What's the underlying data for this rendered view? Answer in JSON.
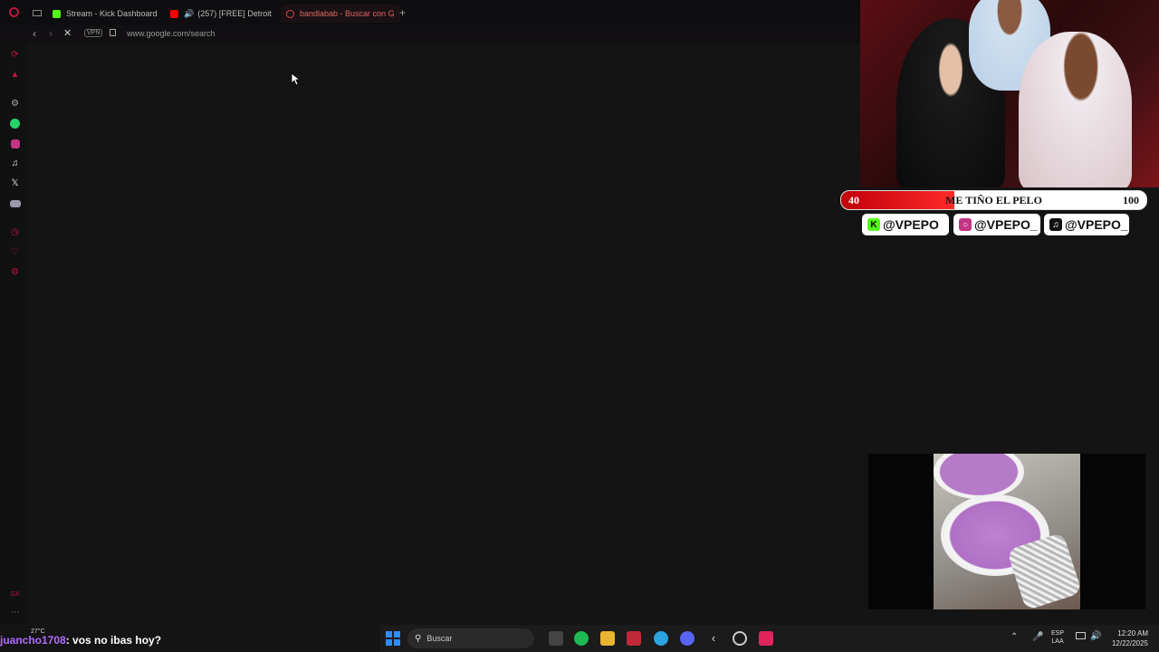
{
  "browser": {
    "tabs": [
      {
        "label": "Stream - Kick Dashboard"
      },
      {
        "label": "(257) [FREE] Detroit T"
      },
      {
        "label": "bandlabab - Buscar con G"
      }
    ],
    "address": {
      "vpn": "VPN",
      "url": "www.google.com/search"
    }
  },
  "overlay": {
    "goal": {
      "start": "40",
      "label": "ME TIÑO EL PELO",
      "end": "100",
      "progress": 0.37
    },
    "socials": [
      {
        "handle": "@VPEPO",
        "icon": "kick-icon"
      },
      {
        "handle": "@VPEPO_",
        "icon": "instagram-icon"
      },
      {
        "handle": "@VPEPO_",
        "icon": "tiktok-icon"
      }
    ]
  },
  "chat": {
    "username": "juancho1708",
    "message": ": vos no ibas hoy?"
  },
  "taskbar": {
    "weather": "27°C",
    "search_placeholder": "Buscar",
    "lang": "ESP",
    "lang_sub": "LAA",
    "time": "12:20 AM",
    "date": "12/22/2025"
  },
  "colors": {
    "accent": "#e0245e",
    "goal_fill": "#e8141c",
    "kick": "#53fc18"
  }
}
